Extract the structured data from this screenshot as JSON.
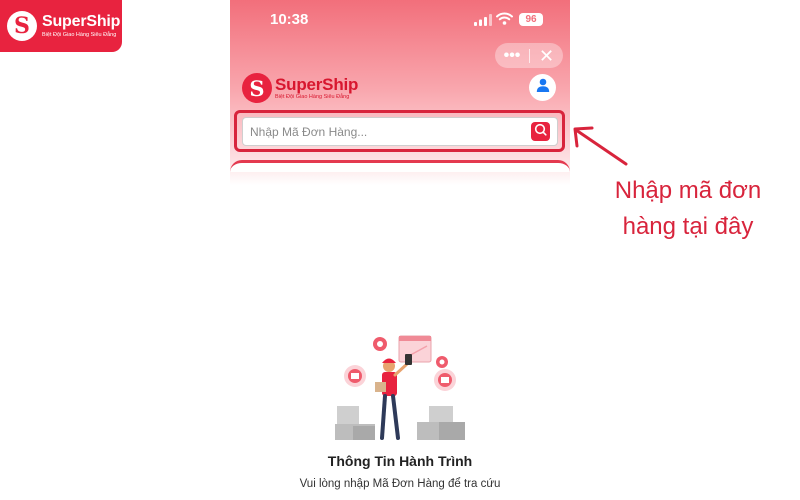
{
  "brand": {
    "name": "SuperShip",
    "tagline": "Biệt Đội Giao Hàng Siêu Đẳng",
    "mark": "S",
    "color": "#e8233f"
  },
  "statusbar": {
    "time": "10:38",
    "battery": "96",
    "icons": [
      "signal-icon",
      "wifi-icon",
      "battery-icon"
    ]
  },
  "miniapp_capsule": {
    "more_label": "•••",
    "close_label": "✕"
  },
  "header": {
    "avatar_icon": "user-icon"
  },
  "search": {
    "placeholder": "Nhập Mã Đơn Hàng...",
    "value": "",
    "button_icon": "search-icon"
  },
  "annotation": {
    "text": "Nhập mã đơn hàng tại đây",
    "color": "#d8243c"
  },
  "empty_state": {
    "title": "Thông Tin Hành Trình",
    "subtitle": "Vui lòng nhập Mã Đơn Hàng để tra cứu",
    "illustration_icon": "delivery-person-illustration"
  }
}
